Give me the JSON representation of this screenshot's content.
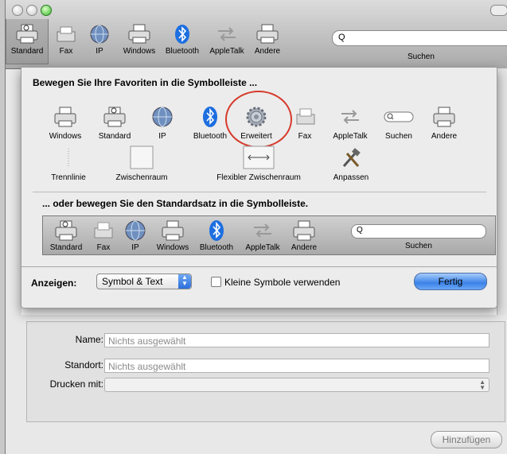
{
  "toolbar": {
    "items": [
      {
        "label": "Standard",
        "icon": "printer-icon"
      },
      {
        "label": "Fax",
        "icon": "fax-icon"
      },
      {
        "label": "IP",
        "icon": "globe-icon"
      },
      {
        "label": "Windows",
        "icon": "windows-printer-icon"
      },
      {
        "label": "Bluetooth",
        "icon": "bluetooth-icon"
      },
      {
        "label": "AppleTalk",
        "icon": "appletalk-icon"
      },
      {
        "label": "Andere",
        "icon": "printer-icon"
      }
    ],
    "search_label": "Suchen",
    "search_glyph": "Q"
  },
  "sheet": {
    "heading_favorites": "Bewegen Sie Ihre Favoriten in die Symbolleiste ...",
    "palette_row1": [
      {
        "label": "Windows",
        "icon": "windows-printer-icon"
      },
      {
        "label": "Standard",
        "icon": "printer-icon"
      },
      {
        "label": "IP",
        "icon": "globe-icon"
      },
      {
        "label": "Bluetooth",
        "icon": "bluetooth-icon"
      },
      {
        "label": "Erweitert",
        "icon": "gear-icon"
      },
      {
        "label": "Fax",
        "icon": "fax-icon"
      },
      {
        "label": "AppleTalk",
        "icon": "appletalk-icon"
      },
      {
        "label": "Suchen",
        "icon": "search-field-icon"
      },
      {
        "label": "Andere",
        "icon": "printer-icon"
      }
    ],
    "palette_row2": [
      {
        "label": "Trennlinie",
        "icon": "separator-icon"
      },
      {
        "label": "Zwischenraum",
        "icon": "space-icon"
      },
      {
        "label": "Flexibler Zwischenraum",
        "icon": "flexible-space-icon"
      },
      {
        "label": "Anpassen",
        "icon": "customize-tools-icon"
      }
    ],
    "heading_default": "... oder bewegen Sie den Standardsatz in die Symbolleiste.",
    "default_set": [
      {
        "label": "Standard",
        "icon": "printer-icon"
      },
      {
        "label": "Fax",
        "icon": "fax-icon"
      },
      {
        "label": "IP",
        "icon": "globe-icon"
      },
      {
        "label": "Windows",
        "icon": "windows-printer-icon"
      },
      {
        "label": "Bluetooth",
        "icon": "bluetooth-icon"
      },
      {
        "label": "AppleTalk",
        "icon": "appletalk-icon"
      },
      {
        "label": "Andere",
        "icon": "printer-icon"
      }
    ],
    "default_search_label": "Suchen",
    "search_glyph": "Q",
    "show_label": "Anzeigen:",
    "show_value": "Symbol & Text",
    "small_icons_label": "Kleine Symbole verwenden",
    "done_label": "Fertig"
  },
  "form": {
    "name_label": "Name:",
    "name_value": "Nichts ausgewählt",
    "location_label": "Standort:",
    "location_value": "Nichts ausgewählt",
    "print_with_label": "Drucken mit:",
    "add_label": "Hinzufügen"
  },
  "colors": {
    "accent": "#3b82e8",
    "highlight_ring": "#d63a2b"
  }
}
